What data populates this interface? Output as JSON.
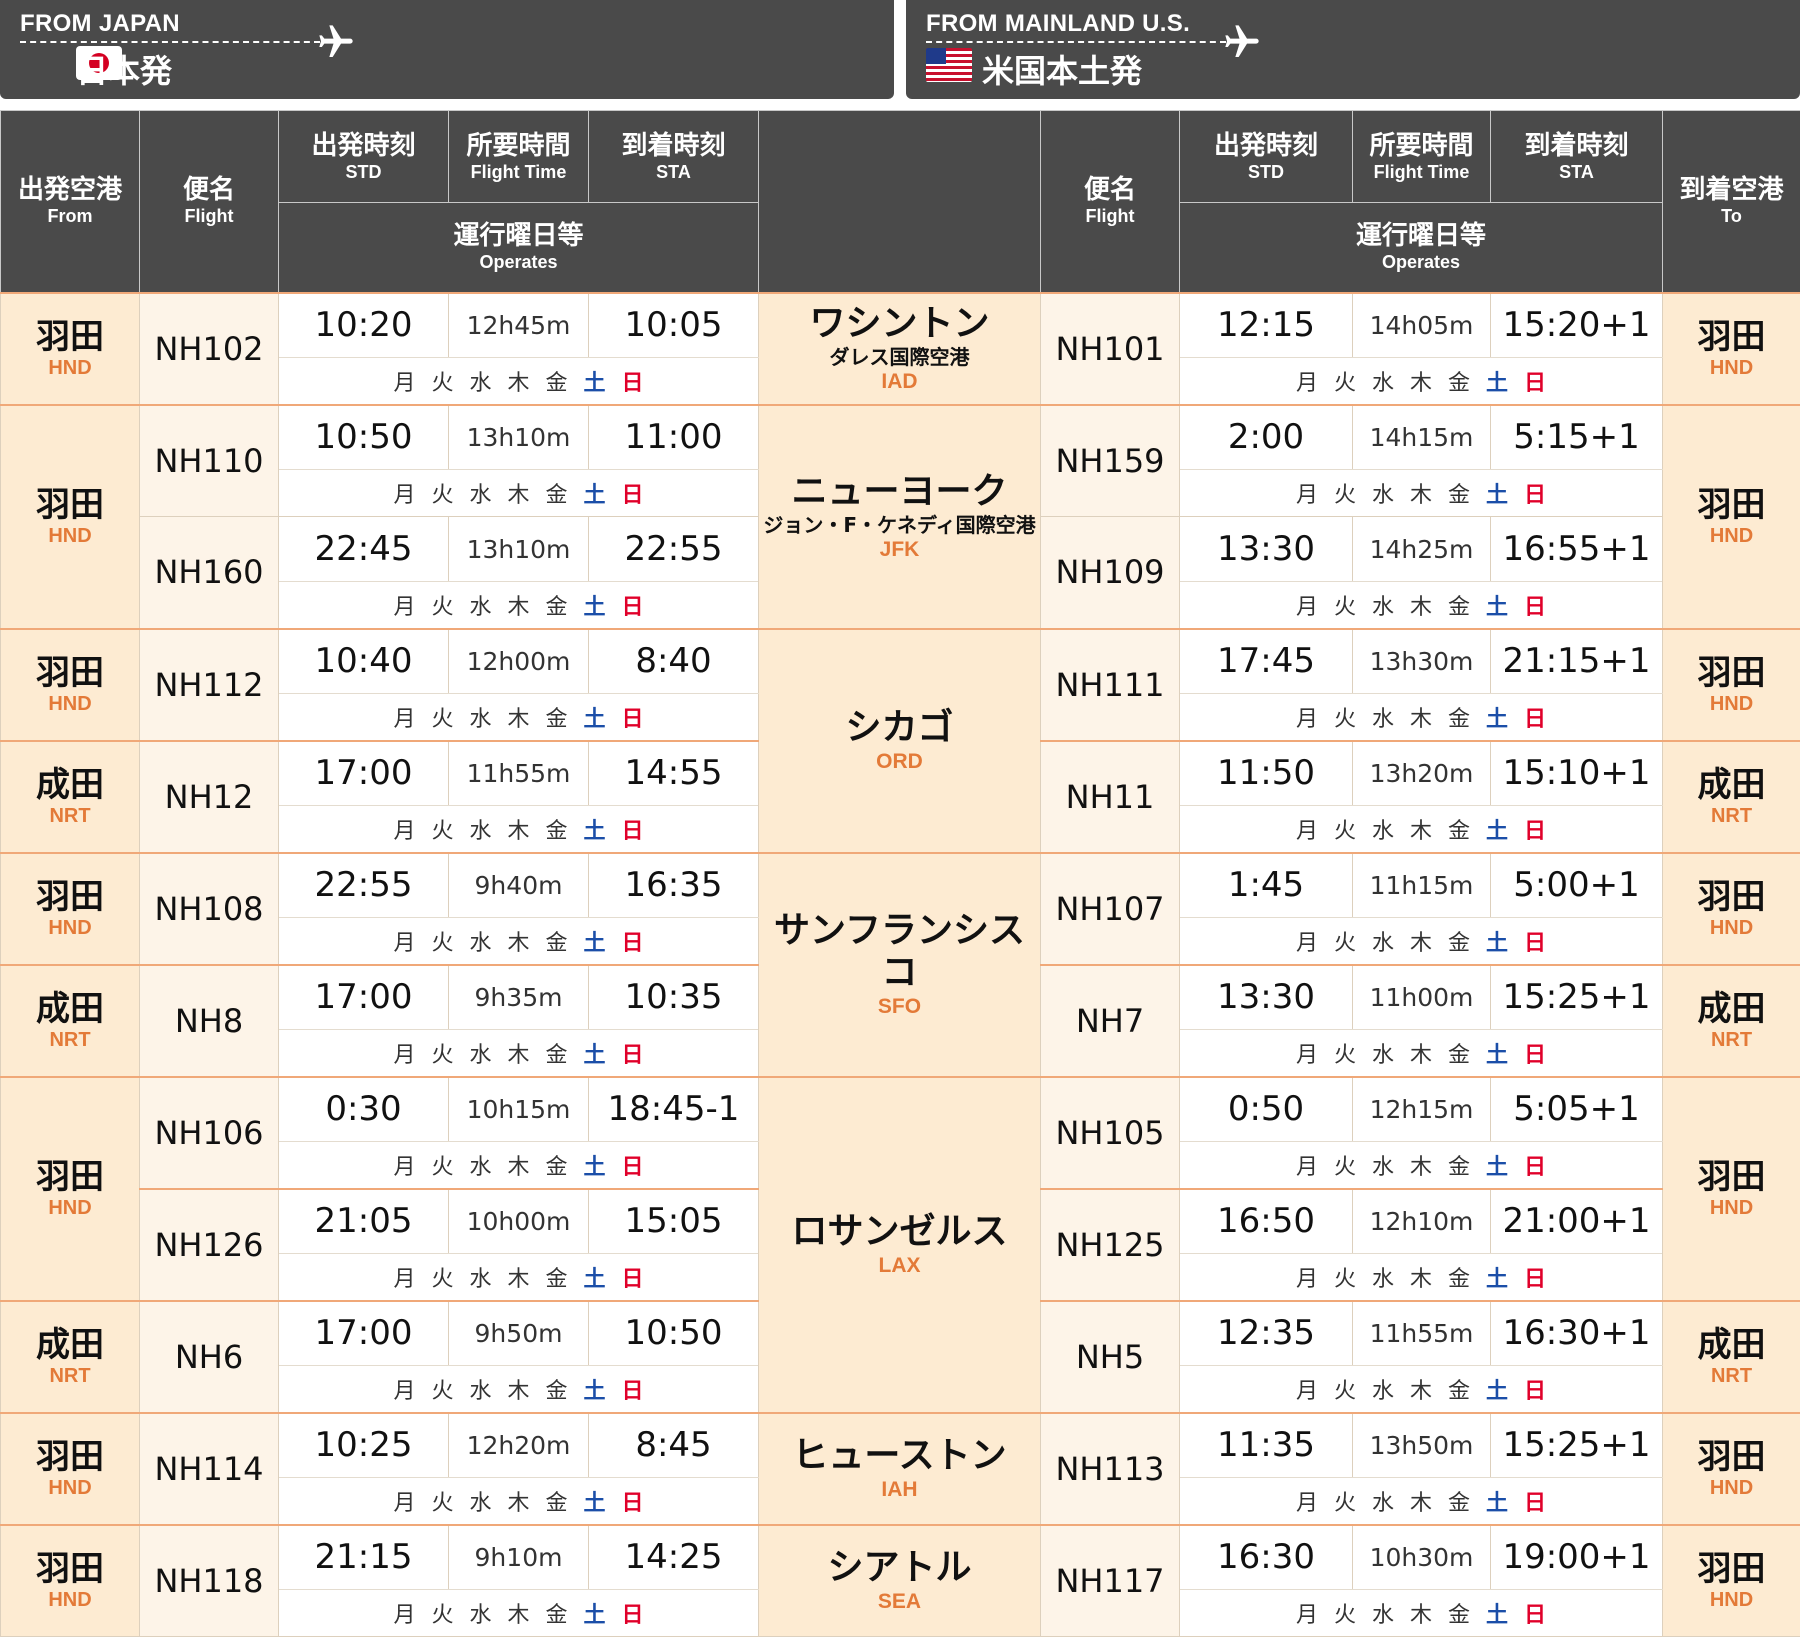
{
  "header": {
    "left_en": "FROM JAPAN",
    "left_jp": "日本発",
    "right_en": "FROM MAINLAND U.S.",
    "right_jp": "米国本土発"
  },
  "columns": {
    "from_jp": "出発空港",
    "from_en": "From",
    "flight_jp": "便名",
    "flight_en": "Flight",
    "std_jp": "出発時刻",
    "std_en": "STD",
    "ft_jp": "所要時間",
    "ft_en": "Flight Time",
    "sta_jp": "到着時刻",
    "sta_en": "STA",
    "ops_jp": "運行曜日等",
    "ops_en": "Operates",
    "to_jp": "到着空港",
    "to_en": "To"
  },
  "days": [
    "月",
    "火",
    "水",
    "木",
    "金",
    "土",
    "日"
  ],
  "rows": [
    {
      "from": {
        "jp": "羽田",
        "code": "HND"
      },
      "flight_l": "NH102",
      "std_l": "10:20",
      "ft_l": "12h45m",
      "sta_l": "10:05",
      "dest": {
        "jp": "ワシントン",
        "sub": "ダレス国際空港",
        "code": "IAD"
      },
      "flight_r": "NH101",
      "std_r": "12:15",
      "ft_r": "14h05m",
      "sta_r": "15:20+1",
      "to": {
        "jp": "羽田",
        "code": "HND"
      }
    },
    {
      "from": {
        "jp": "羽田",
        "code": "HND"
      },
      "flight_l": "NH110",
      "std_l": "10:50",
      "ft_l": "13h10m",
      "sta_l": "11:00",
      "dest": {
        "jp": "ニューヨーク",
        "sub": "ジョン・F・ケネディ国際空港",
        "code": "JFK"
      },
      "flight_r": "NH159",
      "std_r": "2:00",
      "ft_r": "14h15m",
      "sta_r": "5:15+1",
      "to": {
        "jp": "羽田",
        "code": "HND"
      }
    },
    {
      "flight_l": "NH160",
      "std_l": "22:45",
      "ft_l": "13h10m",
      "sta_l": "22:55",
      "flight_r": "NH109",
      "std_r": "13:30",
      "ft_r": "14h25m",
      "sta_r": "16:55+1"
    },
    {
      "from": {
        "jp": "羽田",
        "code": "HND"
      },
      "flight_l": "NH112",
      "std_l": "10:40",
      "ft_l": "12h00m",
      "sta_l": "8:40",
      "dest": {
        "jp": "シカゴ",
        "code": "ORD"
      },
      "flight_r": "NH111",
      "std_r": "17:45",
      "ft_r": "13h30m",
      "sta_r": "21:15+1",
      "to": {
        "jp": "羽田",
        "code": "HND"
      }
    },
    {
      "from": {
        "jp": "成田",
        "code": "NRT"
      },
      "flight_l": "NH12",
      "std_l": "17:00",
      "ft_l": "11h55m",
      "sta_l": "14:55",
      "flight_r": "NH11",
      "std_r": "11:50",
      "ft_r": "13h20m",
      "sta_r": "15:10+1",
      "to": {
        "jp": "成田",
        "code": "NRT"
      }
    },
    {
      "from": {
        "jp": "羽田",
        "code": "HND"
      },
      "flight_l": "NH108",
      "std_l": "22:55",
      "ft_l": "9h40m",
      "sta_l": "16:35",
      "dest": {
        "jp": "サンフランシスコ",
        "code": "SFO"
      },
      "flight_r": "NH107",
      "std_r": "1:45",
      "ft_r": "11h15m",
      "sta_r": "5:00+1",
      "to": {
        "jp": "羽田",
        "code": "HND"
      }
    },
    {
      "from": {
        "jp": "成田",
        "code": "NRT"
      },
      "flight_l": "NH8",
      "std_l": "17:00",
      "ft_l": "9h35m",
      "sta_l": "10:35",
      "flight_r": "NH7",
      "std_r": "13:30",
      "ft_r": "11h00m",
      "sta_r": "15:25+1",
      "to": {
        "jp": "成田",
        "code": "NRT"
      }
    },
    {
      "from": {
        "jp": "羽田",
        "code": "HND"
      },
      "flight_l": "NH106",
      "std_l": "0:30",
      "ft_l": "10h15m",
      "sta_l": "18:45-1",
      "dest": {
        "jp": "ロサンゼルス",
        "code": "LAX"
      },
      "flight_r": "NH105",
      "std_r": "0:50",
      "ft_r": "12h15m",
      "sta_r": "5:05+1",
      "to": {
        "jp": "羽田",
        "code": "HND"
      }
    },
    {
      "flight_l": "NH126",
      "std_l": "21:05",
      "ft_l": "10h00m",
      "sta_l": "15:05",
      "flight_r": "NH125",
      "std_r": "16:50",
      "ft_r": "12h10m",
      "sta_r": "21:00+1"
    },
    {
      "from": {
        "jp": "成田",
        "code": "NRT"
      },
      "flight_l": "NH6",
      "std_l": "17:00",
      "ft_l": "9h50m",
      "sta_l": "10:50",
      "flight_r": "NH5",
      "std_r": "12:35",
      "ft_r": "11h55m",
      "sta_r": "16:30+1",
      "to": {
        "jp": "成田",
        "code": "NRT"
      }
    },
    {
      "from": {
        "jp": "羽田",
        "code": "HND"
      },
      "flight_l": "NH114",
      "std_l": "10:25",
      "ft_l": "12h20m",
      "sta_l": "8:45",
      "dest": {
        "jp": "ヒューストン",
        "code": "IAH"
      },
      "flight_r": "NH113",
      "std_r": "11:35",
      "ft_r": "13h50m",
      "sta_r": "15:25+1",
      "to": {
        "jp": "羽田",
        "code": "HND"
      }
    },
    {
      "from": {
        "jp": "羽田",
        "code": "HND"
      },
      "flight_l": "NH118",
      "std_l": "21:15",
      "ft_l": "9h10m",
      "sta_l": "14:25",
      "dest": {
        "jp": "シアトル",
        "code": "SEA"
      },
      "flight_r": "NH117",
      "std_r": "16:30",
      "ft_r": "10h30m",
      "sta_r": "19:00+1",
      "to": {
        "jp": "羽田",
        "code": "HND"
      }
    }
  ]
}
